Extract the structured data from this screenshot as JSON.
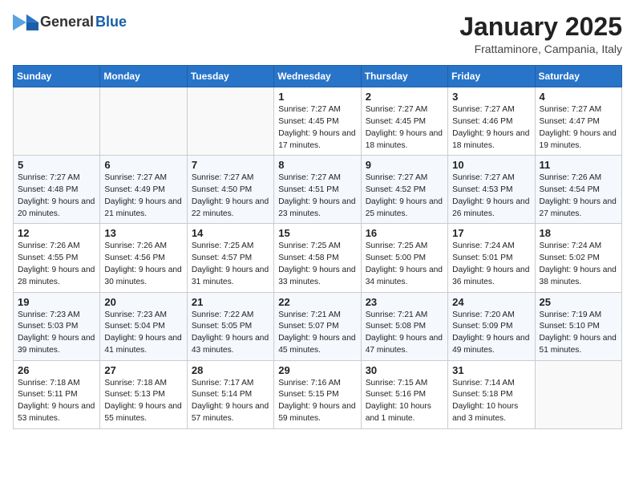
{
  "header": {
    "logo_general": "General",
    "logo_blue": "Blue",
    "month_title": "January 2025",
    "location": "Frattaminore, Campania, Italy"
  },
  "weekdays": [
    "Sunday",
    "Monday",
    "Tuesday",
    "Wednesday",
    "Thursday",
    "Friday",
    "Saturday"
  ],
  "weeks": [
    [
      {
        "day": "",
        "sunrise": "",
        "sunset": "",
        "daylight": ""
      },
      {
        "day": "",
        "sunrise": "",
        "sunset": "",
        "daylight": ""
      },
      {
        "day": "",
        "sunrise": "",
        "sunset": "",
        "daylight": ""
      },
      {
        "day": "1",
        "sunrise": "Sunrise: 7:27 AM",
        "sunset": "Sunset: 4:45 PM",
        "daylight": "Daylight: 9 hours and 17 minutes."
      },
      {
        "day": "2",
        "sunrise": "Sunrise: 7:27 AM",
        "sunset": "Sunset: 4:45 PM",
        "daylight": "Daylight: 9 hours and 18 minutes."
      },
      {
        "day": "3",
        "sunrise": "Sunrise: 7:27 AM",
        "sunset": "Sunset: 4:46 PM",
        "daylight": "Daylight: 9 hours and 18 minutes."
      },
      {
        "day": "4",
        "sunrise": "Sunrise: 7:27 AM",
        "sunset": "Sunset: 4:47 PM",
        "daylight": "Daylight: 9 hours and 19 minutes."
      }
    ],
    [
      {
        "day": "5",
        "sunrise": "Sunrise: 7:27 AM",
        "sunset": "Sunset: 4:48 PM",
        "daylight": "Daylight: 9 hours and 20 minutes."
      },
      {
        "day": "6",
        "sunrise": "Sunrise: 7:27 AM",
        "sunset": "Sunset: 4:49 PM",
        "daylight": "Daylight: 9 hours and 21 minutes."
      },
      {
        "day": "7",
        "sunrise": "Sunrise: 7:27 AM",
        "sunset": "Sunset: 4:50 PM",
        "daylight": "Daylight: 9 hours and 22 minutes."
      },
      {
        "day": "8",
        "sunrise": "Sunrise: 7:27 AM",
        "sunset": "Sunset: 4:51 PM",
        "daylight": "Daylight: 9 hours and 23 minutes."
      },
      {
        "day": "9",
        "sunrise": "Sunrise: 7:27 AM",
        "sunset": "Sunset: 4:52 PM",
        "daylight": "Daylight: 9 hours and 25 minutes."
      },
      {
        "day": "10",
        "sunrise": "Sunrise: 7:27 AM",
        "sunset": "Sunset: 4:53 PM",
        "daylight": "Daylight: 9 hours and 26 minutes."
      },
      {
        "day": "11",
        "sunrise": "Sunrise: 7:26 AM",
        "sunset": "Sunset: 4:54 PM",
        "daylight": "Daylight: 9 hours and 27 minutes."
      }
    ],
    [
      {
        "day": "12",
        "sunrise": "Sunrise: 7:26 AM",
        "sunset": "Sunset: 4:55 PM",
        "daylight": "Daylight: 9 hours and 28 minutes."
      },
      {
        "day": "13",
        "sunrise": "Sunrise: 7:26 AM",
        "sunset": "Sunset: 4:56 PM",
        "daylight": "Daylight: 9 hours and 30 minutes."
      },
      {
        "day": "14",
        "sunrise": "Sunrise: 7:25 AM",
        "sunset": "Sunset: 4:57 PM",
        "daylight": "Daylight: 9 hours and 31 minutes."
      },
      {
        "day": "15",
        "sunrise": "Sunrise: 7:25 AM",
        "sunset": "Sunset: 4:58 PM",
        "daylight": "Daylight: 9 hours and 33 minutes."
      },
      {
        "day": "16",
        "sunrise": "Sunrise: 7:25 AM",
        "sunset": "Sunset: 5:00 PM",
        "daylight": "Daylight: 9 hours and 34 minutes."
      },
      {
        "day": "17",
        "sunrise": "Sunrise: 7:24 AM",
        "sunset": "Sunset: 5:01 PM",
        "daylight": "Daylight: 9 hours and 36 minutes."
      },
      {
        "day": "18",
        "sunrise": "Sunrise: 7:24 AM",
        "sunset": "Sunset: 5:02 PM",
        "daylight": "Daylight: 9 hours and 38 minutes."
      }
    ],
    [
      {
        "day": "19",
        "sunrise": "Sunrise: 7:23 AM",
        "sunset": "Sunset: 5:03 PM",
        "daylight": "Daylight: 9 hours and 39 minutes."
      },
      {
        "day": "20",
        "sunrise": "Sunrise: 7:23 AM",
        "sunset": "Sunset: 5:04 PM",
        "daylight": "Daylight: 9 hours and 41 minutes."
      },
      {
        "day": "21",
        "sunrise": "Sunrise: 7:22 AM",
        "sunset": "Sunset: 5:05 PM",
        "daylight": "Daylight: 9 hours and 43 minutes."
      },
      {
        "day": "22",
        "sunrise": "Sunrise: 7:21 AM",
        "sunset": "Sunset: 5:07 PM",
        "daylight": "Daylight: 9 hours and 45 minutes."
      },
      {
        "day": "23",
        "sunrise": "Sunrise: 7:21 AM",
        "sunset": "Sunset: 5:08 PM",
        "daylight": "Daylight: 9 hours and 47 minutes."
      },
      {
        "day": "24",
        "sunrise": "Sunrise: 7:20 AM",
        "sunset": "Sunset: 5:09 PM",
        "daylight": "Daylight: 9 hours and 49 minutes."
      },
      {
        "day": "25",
        "sunrise": "Sunrise: 7:19 AM",
        "sunset": "Sunset: 5:10 PM",
        "daylight": "Daylight: 9 hours and 51 minutes."
      }
    ],
    [
      {
        "day": "26",
        "sunrise": "Sunrise: 7:18 AM",
        "sunset": "Sunset: 5:11 PM",
        "daylight": "Daylight: 9 hours and 53 minutes."
      },
      {
        "day": "27",
        "sunrise": "Sunrise: 7:18 AM",
        "sunset": "Sunset: 5:13 PM",
        "daylight": "Daylight: 9 hours and 55 minutes."
      },
      {
        "day": "28",
        "sunrise": "Sunrise: 7:17 AM",
        "sunset": "Sunset: 5:14 PM",
        "daylight": "Daylight: 9 hours and 57 minutes."
      },
      {
        "day": "29",
        "sunrise": "Sunrise: 7:16 AM",
        "sunset": "Sunset: 5:15 PM",
        "daylight": "Daylight: 9 hours and 59 minutes."
      },
      {
        "day": "30",
        "sunrise": "Sunrise: 7:15 AM",
        "sunset": "Sunset: 5:16 PM",
        "daylight": "Daylight: 10 hours and 1 minute."
      },
      {
        "day": "31",
        "sunrise": "Sunrise: 7:14 AM",
        "sunset": "Sunset: 5:18 PM",
        "daylight": "Daylight: 10 hours and 3 minutes."
      },
      {
        "day": "",
        "sunrise": "",
        "sunset": "",
        "daylight": ""
      }
    ]
  ]
}
